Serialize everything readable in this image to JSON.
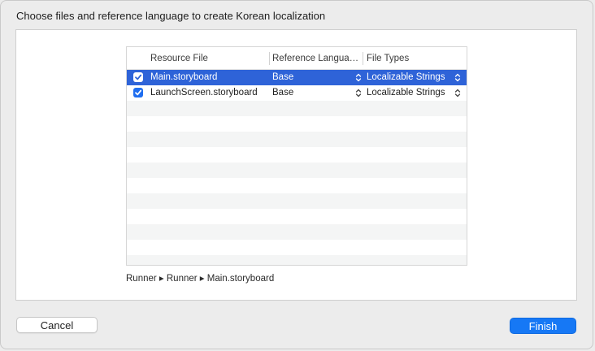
{
  "dialog": {
    "title": "Choose files and reference language to create Korean localization"
  },
  "table": {
    "columns": {
      "resource_file": "Resource File",
      "reference_language": "Reference Langua…",
      "file_types": "File Types"
    },
    "rows": [
      {
        "checked": true,
        "file": "Main.storyboard",
        "language": "Base",
        "type": "Localizable Strings",
        "selected": true
      },
      {
        "checked": true,
        "file": "LaunchScreen.storyboard",
        "language": "Base",
        "type": "Localizable Strings",
        "selected": false
      }
    ]
  },
  "path_bar": {
    "text": "Runner ▸ Runner ▸ Main.storyboard"
  },
  "buttons": {
    "cancel": "Cancel",
    "finish": "Finish"
  },
  "colors": {
    "selection": "#2e63d8",
    "accent": "#1678f5",
    "checkbox": "#1f6ef0"
  }
}
